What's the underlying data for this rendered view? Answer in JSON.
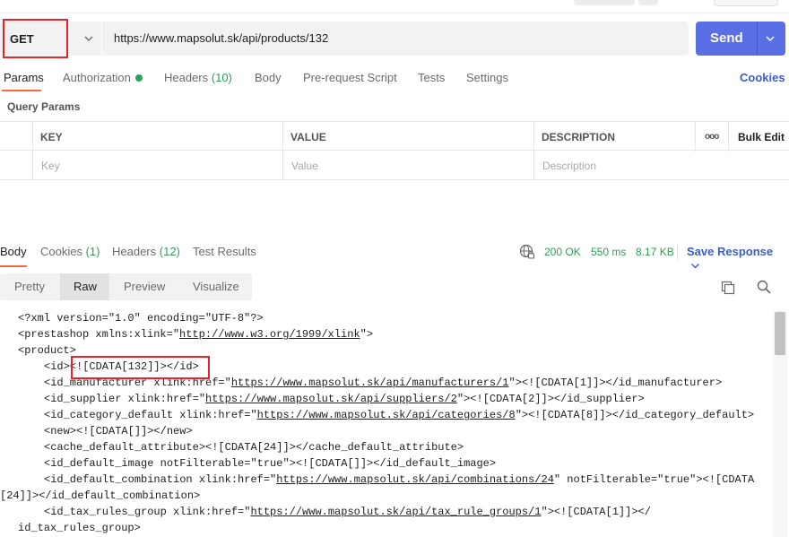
{
  "request": {
    "method": "GET",
    "url": "https://www.mapsolut.sk/api/products/132",
    "send_label": "Send"
  },
  "req_tabs": {
    "params": "Params",
    "authorization": "Authorization",
    "headers": "Headers",
    "headers_count": "(10)",
    "body": "Body",
    "prerequest": "Pre-request Script",
    "tests": "Tests",
    "settings": "Settings",
    "cookies": "Cookies"
  },
  "query_params": {
    "title": "Query Params",
    "columns": [
      "KEY",
      "VALUE",
      "DESCRIPTION"
    ],
    "more_label": "ooo",
    "bulk_edit": "Bulk Edit",
    "placeholders": [
      "Key",
      "Value",
      "Description"
    ]
  },
  "response": {
    "tabs": {
      "body": "Body",
      "cookies": "Cookies",
      "cookies_count": "(1)",
      "headers": "Headers",
      "headers_count": "(12)",
      "test_results": "Test Results"
    },
    "status": "200 OK",
    "time": "550 ms",
    "size": "8.17 KB",
    "save_response": "Save Response",
    "views": [
      "Pretty",
      "Raw",
      "Preview",
      "Visualize"
    ],
    "code": {
      "l1": "<?xml version=\"1.0\" encoding=\"UTF-8\"?>",
      "l2a": "<prestashop xmlns:xlink=\"",
      "l2u": "http://www.w3.org/1999/xlink",
      "l2b": "\">",
      "l3": "<product>",
      "l4": "<id><![CDATA[132]]></id>",
      "l5a": "<id_manufacturer xlink:href=\"",
      "l5u": "https://www.mapsolut.sk/api/manufacturers/1",
      "l5b": "\"><![CDATA[1]]></id_manufacturer>",
      "l6a": "<id_supplier xlink:href=\"",
      "l6u": "https://www.mapsolut.sk/api/suppliers/2",
      "l6b": "\"><![CDATA[2]]></id_supplier>",
      "l7a": "<id_category_default xlink:href=\"",
      "l7u": "https://www.mapsolut.sk/api/categories/8",
      "l7b": "\"><![CDATA[8]]></id_category_default>",
      "l8": "<new><![CDATA[]]></new>",
      "l9": "<cache_default_attribute><![CDATA[24]]></cache_default_attribute>",
      "l10": "<id_default_image notFilterable=\"true\"><![CDATA[]]></id_default_image>",
      "l11a": "<id_default_combination xlink:href=\"",
      "l11u": "https://www.mapsolut.sk/api/combinations/24",
      "l11b": "\" notFilterable=\"true\"><![CDATA",
      "l12": "[24]]></id_default_combination>",
      "l13a": "<id_tax_rules_group xlink:href=\"",
      "l13u": "https://www.mapsolut.sk/api/tax_rule_groups/1",
      "l13b": "\"><![CDATA[1]]></",
      "l14": "id_tax_rules_group>"
    }
  },
  "colors": {
    "accent": "#f26b3a",
    "send": "#5a6ee6",
    "link": "#3b5bcb",
    "success": "#2e9e57",
    "highlight": "#e3242b"
  }
}
